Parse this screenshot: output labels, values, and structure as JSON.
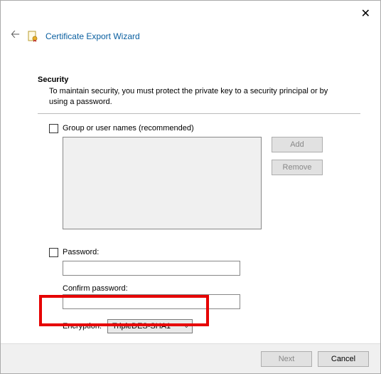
{
  "window": {
    "title": "Certificate Export Wizard"
  },
  "section": {
    "heading": "Security",
    "description": "To maintain security, you must protect the private key to a security principal or by using a password."
  },
  "form": {
    "group_checkbox_label": "Group or user names (recommended)",
    "add_button": "Add",
    "remove_button": "Remove",
    "password_label": "Password:",
    "confirm_label": "Confirm password:",
    "encryption_label": "Encryption:",
    "encryption_value": "TripleDES-SHA1"
  },
  "footer": {
    "next": "Next",
    "cancel": "Cancel"
  }
}
